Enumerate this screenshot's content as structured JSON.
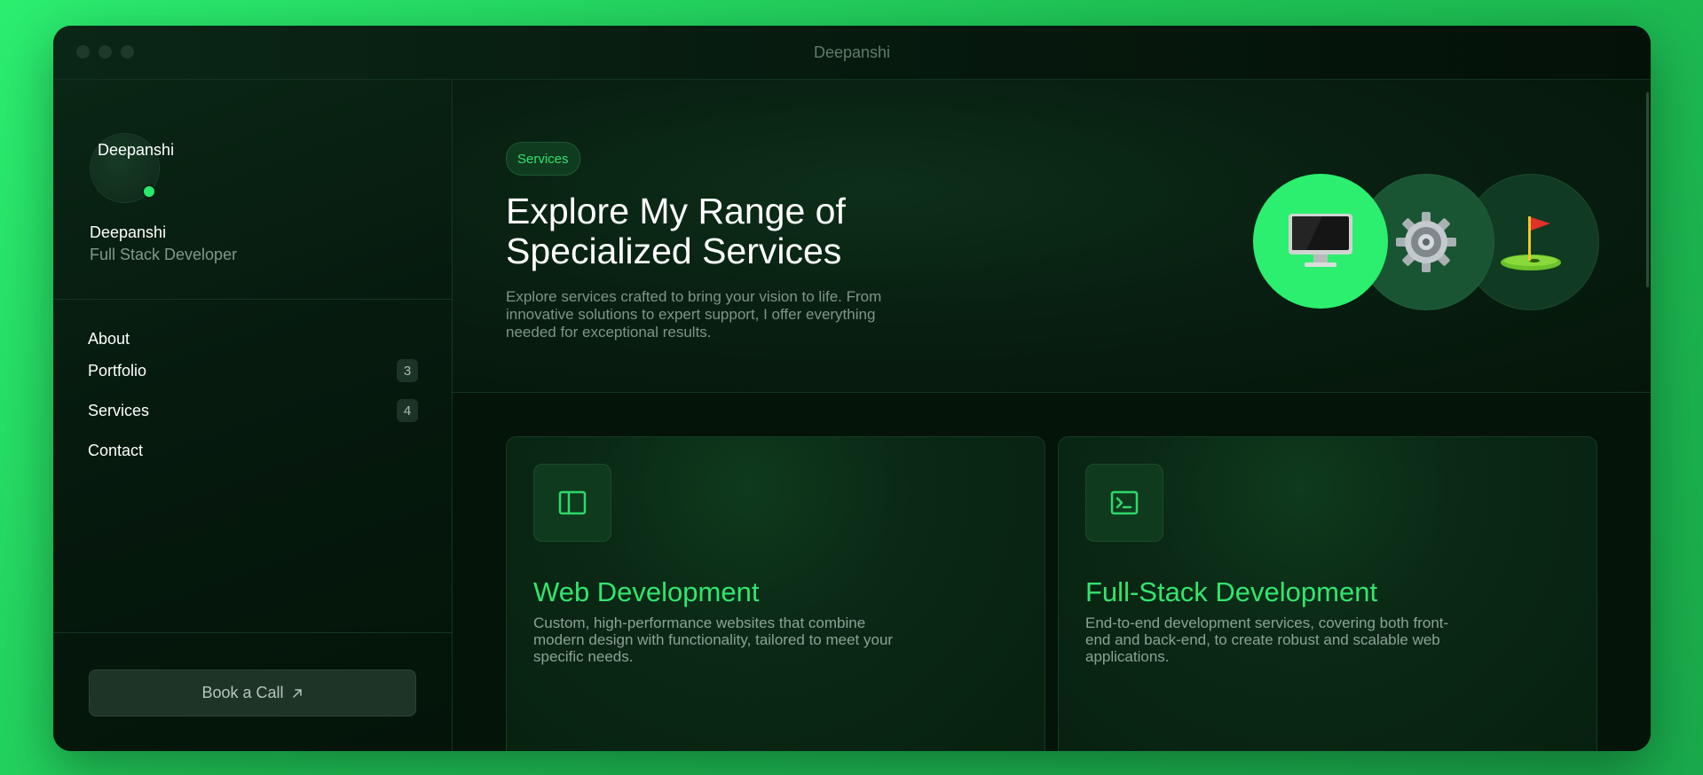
{
  "window": {
    "title": "Deepanshi"
  },
  "profile": {
    "avatar_label": "Deepanshi",
    "name": "Deepanshi",
    "role": "Full Stack Developer"
  },
  "nav": {
    "items": [
      {
        "label": "About",
        "count": null
      },
      {
        "label": "Portfolio",
        "count": "3"
      },
      {
        "label": "Services",
        "count": "4"
      },
      {
        "label": "Contact",
        "count": null
      }
    ]
  },
  "cta": {
    "label": "Book a Call",
    "icon": "arrow-up-right-icon"
  },
  "hero": {
    "tag": "Services",
    "title_line1": "Explore My Range of",
    "title_line2": "Specialized Services",
    "description": "Explore services crafted to bring your vision to life. From innovative solutions to expert support, I offer everything needed for exceptional results.",
    "icons": [
      "desktop-computer-icon",
      "gear-icon",
      "golf-flag-icon"
    ]
  },
  "services": [
    {
      "title": "Web Development",
      "description": "Custom, high-performance websites that combine modern design with functionality, tailored to meet your specific needs.",
      "icon": "sidebar-layout-icon"
    },
    {
      "title": "Full-Stack Development",
      "description": "End-to-end development services, covering both front-end and back-end, to create robust and scalable web applications.",
      "icon": "terminal-icon"
    }
  ],
  "colors": {
    "accent": "#2cef6f",
    "background": "#04190d",
    "page_gradient_start": "#2bee6f"
  }
}
